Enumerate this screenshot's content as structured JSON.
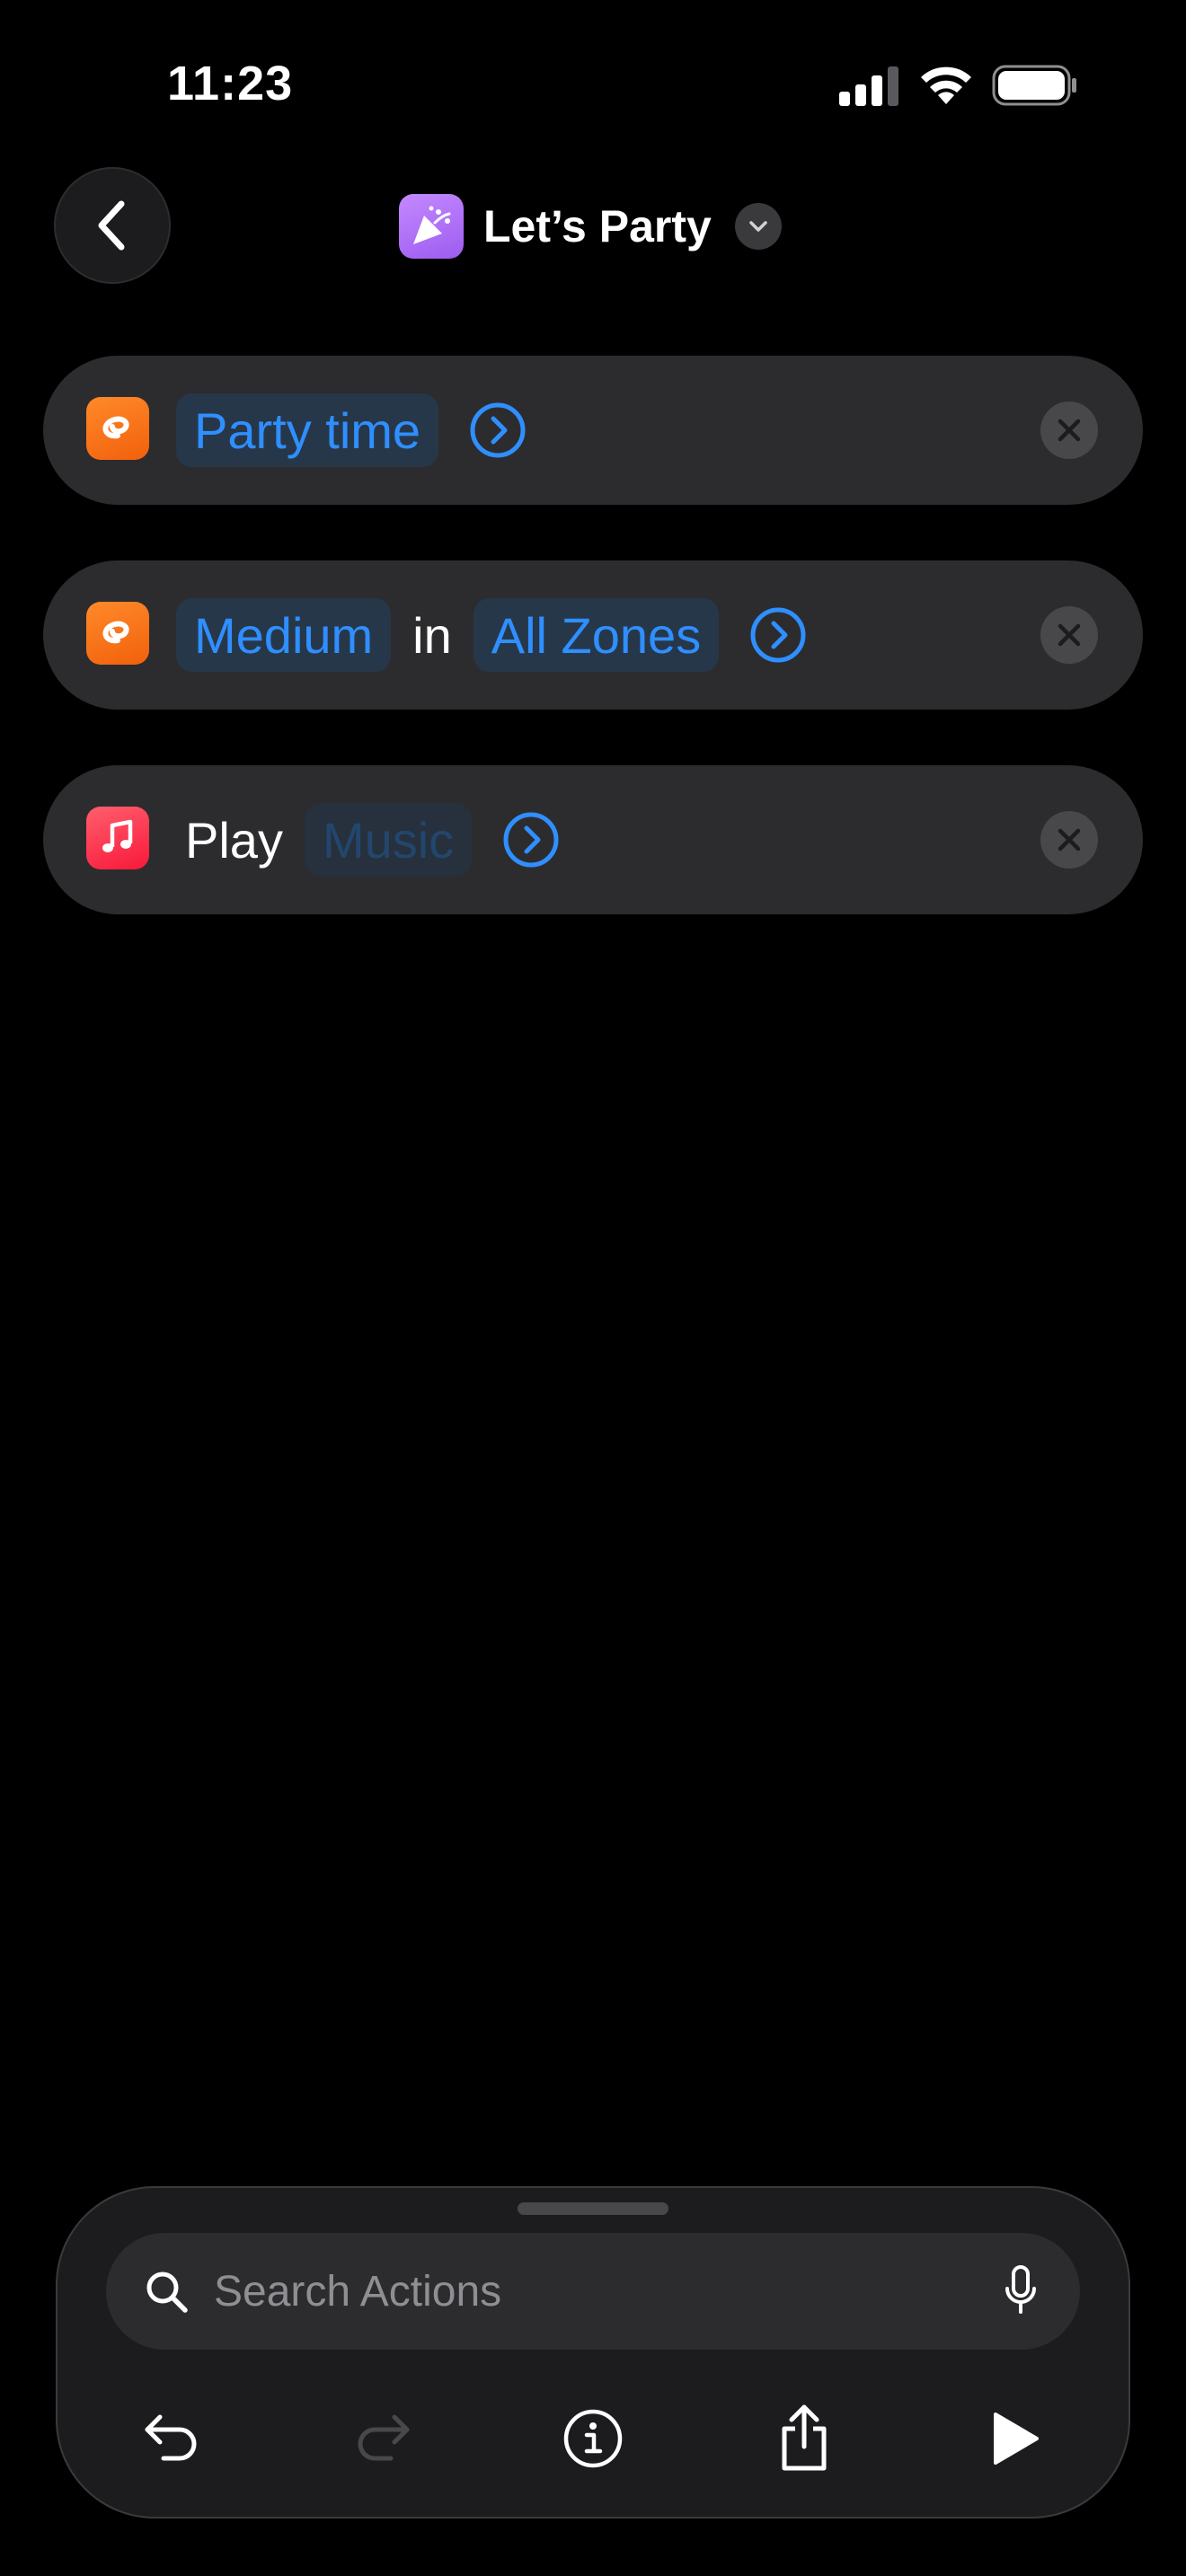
{
  "status_bar": {
    "time": "11:23",
    "icons": [
      "signal-icon",
      "wifi-icon",
      "battery-icon"
    ]
  },
  "nav": {
    "back_icon": "chevron-left-icon",
    "app_icon": "party-popper-icon",
    "title": "Let’s Party",
    "title_menu_icon": "chevron-down-icon"
  },
  "actions": [
    {
      "icon": "orange-app-icon",
      "parts": {
        "token1": "Party time"
      },
      "expand_icon": "chevron-right-circle-icon",
      "remove_icon": "close-icon"
    },
    {
      "icon": "orange-app-icon",
      "parts": {
        "token1": "Medium",
        "connector": "in",
        "token2": "All Zones"
      },
      "expand_icon": "chevron-right-circle-icon",
      "remove_icon": "close-icon"
    },
    {
      "icon": "music-icon",
      "parts": {
        "verb": "Play",
        "token1": "Music"
      },
      "expand_icon": "chevron-right-circle-icon",
      "remove_icon": "close-icon"
    }
  ],
  "search": {
    "placeholder": "Search Actions",
    "icon": "search-icon",
    "mic_icon": "microphone-icon"
  },
  "toolbar": {
    "buttons": [
      "undo-icon",
      "redo-icon",
      "info-icon",
      "share-icon",
      "play-icon"
    ]
  },
  "colors": {
    "background": "#000000",
    "card": "#2c2c2e",
    "accent": "#2f8fff",
    "token_bg": "#27374a",
    "sheet": "#1c1c1e"
  }
}
